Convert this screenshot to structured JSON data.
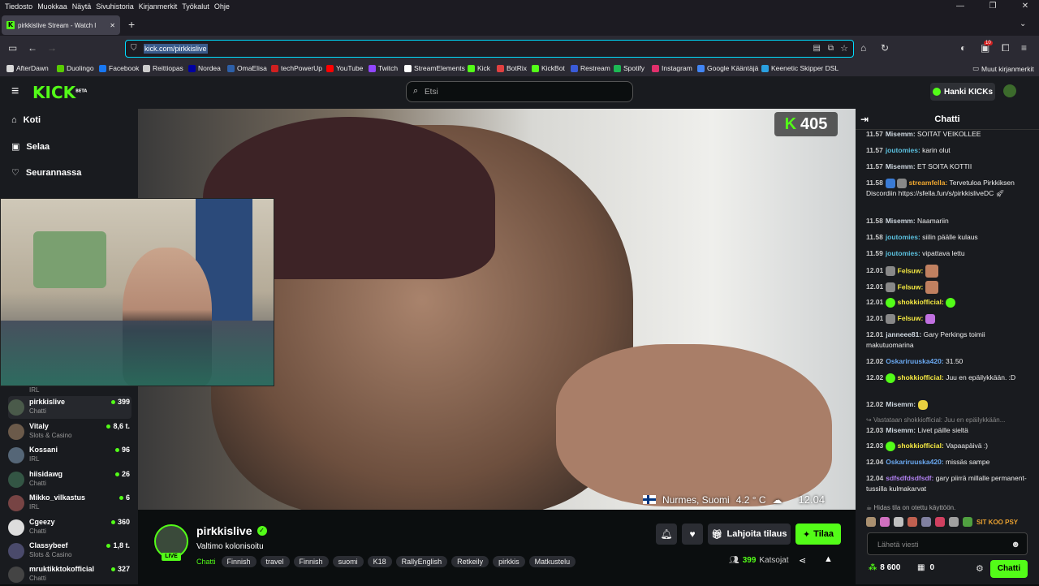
{
  "menubar": {
    "items": [
      "Tiedosto",
      "Muokkaa",
      "Näytä",
      "Sivuhistoria",
      "Kirjanmerkit",
      "Työkalut",
      "Ohje"
    ]
  },
  "tab": {
    "title": "pirkkislive Stream - Watch l",
    "new_tab": "+"
  },
  "navbar": {
    "url_prefix": "",
    "url": "kick.com/pirkkislive",
    "notif_badge": "10"
  },
  "bookmarks": [
    {
      "label": "AfterDawn",
      "color": "#d8d8d8"
    },
    {
      "label": "Duolingo",
      "color": "#58cc02"
    },
    {
      "label": "Facebook",
      "color": "#1877f2"
    },
    {
      "label": "Reittiopas",
      "color": "#cccccc"
    },
    {
      "label": "Nordea",
      "color": "#0000a0"
    },
    {
      "label": "OmaElisa",
      "color": "#2d5fa8"
    },
    {
      "label": "techPowerUp",
      "color": "#d02020"
    },
    {
      "label": "YouTube",
      "color": "#ff0000"
    },
    {
      "label": "Twitch",
      "color": "#9146ff"
    },
    {
      "label": "StreamElements",
      "color": "#ffffff"
    },
    {
      "label": "Kick",
      "color": "#53fc18"
    },
    {
      "label": "BotRix",
      "color": "#e04040"
    },
    {
      "label": "KickBot",
      "color": "#53fc18"
    },
    {
      "label": "Restream",
      "color": "#3a5bd8"
    },
    {
      "label": "Spotify",
      "color": "#1db954"
    },
    {
      "label": "Instagram",
      "color": "#e1306c"
    },
    {
      "label": "Google Kääntäjä",
      "color": "#4285f4"
    },
    {
      "label": "Keenetic Skipper DSL",
      "color": "#2aa0e0"
    }
  ],
  "bookmarks_other": "Muut kirjanmerkit",
  "header": {
    "logo": "KICK",
    "logo_beta": "BETA",
    "search_placeholder": "Etsi",
    "get_kicks": "Hanki KICKs"
  },
  "sidebar": {
    "nav": [
      {
        "label": "Koti",
        "icon": "home-icon"
      },
      {
        "label": "Selaa",
        "icon": "browse-icon"
      },
      {
        "label": "Seurannassa",
        "icon": "heart-icon"
      }
    ],
    "partial_category": "IRL",
    "channels": [
      {
        "name": "pirkkislive",
        "category": "Chatti",
        "viewers": "399",
        "color": "#4a5a4a"
      },
      {
        "name": "Vitaly",
        "category": "Slots & Casino",
        "viewers": "8,6 t.",
        "color": "#6b5a4a"
      },
      {
        "name": "Kossani",
        "category": "IRL",
        "viewers": "96",
        "color": "#556677"
      },
      {
        "name": "hiisidawg",
        "category": "Chatti",
        "viewers": "26",
        "color": "#335544"
      },
      {
        "name": "Mikko_vilkastus",
        "category": "IRL",
        "viewers": "6",
        "color": "#774444"
      },
      {
        "name": "Cgeezy",
        "category": "Chatti",
        "viewers": "360",
        "color": "#dddddd"
      },
      {
        "name": "Classybeef",
        "category": "Slots & Casino",
        "viewers": "1,8 t.",
        "color": "#4a4a6b"
      },
      {
        "name": "mruktikktokofficial",
        "category": "Chatti",
        "viewers": "327",
        "color": "#444444"
      }
    ]
  },
  "video": {
    "kick_count": "405",
    "location": "Nurmes, Suomi",
    "temperature": "4.2 ° C",
    "time": "12.04"
  },
  "stream": {
    "streamer": "pirkkislive",
    "live": "LIVE",
    "title": "Valtimo kolonisoitu",
    "category": "Chatti",
    "tags": [
      "Finnish",
      "travel",
      "Finnish",
      "suomi",
      "K18",
      "RallyEnglish",
      "Retkeily",
      "pirkkis",
      "Matkustelu"
    ],
    "gift_label": "Lahjoita tilaus",
    "subscribe_label": "Tilaa",
    "viewer_count": "399",
    "viewer_label": "Katsojat"
  },
  "chat": {
    "title": "Chatti",
    "messages": [
      {
        "time": "11.57",
        "user": "Misemm:",
        "color": "#cfd8e0",
        "text": "SOITAT VEIKOLLEE"
      },
      {
        "time": "11.57",
        "user": "joutomies:",
        "color": "#5bc0de",
        "text": "karin olut"
      },
      {
        "time": "11.57",
        "user": "Misemm:",
        "color": "#cfd8e0",
        "text": "ET SOITA KOTTII"
      },
      {
        "time": "11.58",
        "user": "streamfella:",
        "color": "#f0a830",
        "text": "Tervetuloa Pirkkiksen Discordiin https://sfella.fun/s/pirkkisliveDC"
      },
      {
        "time": "11.58",
        "user": "Misemm:",
        "color": "#cfd8e0",
        "text": "Naamariin"
      },
      {
        "time": "11.58",
        "user": "joutomies:",
        "color": "#5bc0de",
        "text": "siilin päälle kulaus"
      },
      {
        "time": "11.59",
        "user": "joutomies:",
        "color": "#5bc0de",
        "text": "vipattava lettu"
      },
      {
        "time": "12.01",
        "user": "Felsuw:",
        "color": "#f4e842",
        "text": ""
      },
      {
        "time": "12.01",
        "user": "Felsuw:",
        "color": "#f4e842",
        "text": ""
      },
      {
        "time": "12.01",
        "user": "shokkiofficial:",
        "color": "#f4e842",
        "text": ""
      },
      {
        "time": "12.01",
        "user": "Felsuw:",
        "color": "#f4e842",
        "text": ""
      },
      {
        "time": "12.01",
        "user": "janneee81:",
        "color": "#cfd8e0",
        "text": "Gary Perkings toimii makutuomarina"
      },
      {
        "time": "12.02",
        "user": "Oskariruuska420:",
        "color": "#6aa8f0",
        "text": "31.50"
      },
      {
        "time": "12.02",
        "user": "shokkiofficial:",
        "color": "#f4e842",
        "text": "Juu en epäilykkään. :D"
      },
      {
        "time": "12.02",
        "user": "Misemm:",
        "color": "#cfd8e0",
        "text": ""
      },
      {
        "time": "12.03",
        "user": "Misemm:",
        "color": "#cfd8e0",
        "text": "Livet päille sieltä"
      },
      {
        "time": "12.03",
        "user": "shokkiofficial:",
        "color": "#f4e842",
        "text": "Vapaapäivä :)"
      },
      {
        "time": "12.04",
        "user": "Oskariruuska420:",
        "color": "#6aa8f0",
        "text": "missäs sampe"
      },
      {
        "time": "12.04",
        "user": "sdfsdfdsdfsdf:",
        "color": "#b080f0",
        "text": "gary piirrä millalle permanent- tussilla kulmakarvat"
      }
    ],
    "reply_context": "Vastataan shokkiofficial: Juu en epäilykkään...",
    "slow_mode": "Hidas tila on otettu käyttöön.",
    "emote_text": "SIT KOO PSY",
    "input_placeholder": "Lähetä viesti",
    "kicks_balance": "8 600",
    "points": "0",
    "send_label": "Chatti"
  },
  "colors": {
    "brand": "#53fc18",
    "bg": "#0b0e0f",
    "panel": "#191b1f"
  }
}
